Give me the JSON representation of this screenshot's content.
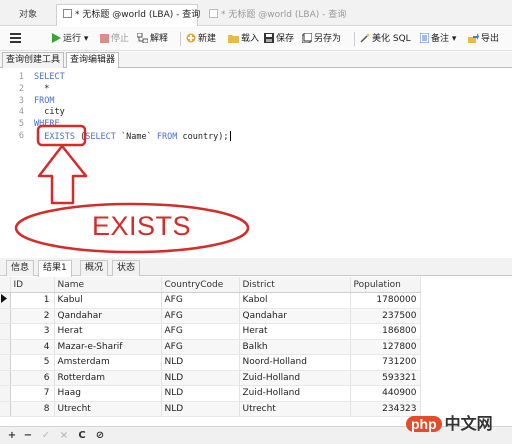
{
  "window_tabs": {
    "objects": "对象",
    "active": "* 无标题 @world (LBA) - 查询",
    "inactive": "* 无标题 @world (LBA) - 查询"
  },
  "toolbar": {
    "menu_icon": "hamburger-icon",
    "run": "运行 ▾",
    "stop": "停止",
    "explain": "解释",
    "new": "新建",
    "load": "载入",
    "save": "保存",
    "save_as": "另存为",
    "beautify": "美化 SQL",
    "memo": "备注 ▾",
    "export": "导出"
  },
  "sub_tabs": {
    "builder": "查询创建工具",
    "editor": "查询编辑器"
  },
  "editor": {
    "lines": [
      {
        "n": "1",
        "html_parts": [
          {
            "t": "SELECT",
            "kw": true
          }
        ]
      },
      {
        "n": "2",
        "html_parts": [
          {
            "t": "  *",
            "kw": false
          }
        ]
      },
      {
        "n": "3",
        "html_parts": [
          {
            "t": "FROM",
            "kw": true
          }
        ]
      },
      {
        "n": "4",
        "html_parts": [
          {
            "t": "  city",
            "kw": false
          }
        ]
      },
      {
        "n": "5",
        "html_parts": [
          {
            "t": "WHERE",
            "kw": true
          }
        ]
      },
      {
        "n": "6",
        "html_parts": [
          {
            "t": "  EXISTS",
            "kw": true
          },
          {
            "t": " (",
            "kw": false
          },
          {
            "t": "SELECT",
            "kw": true
          },
          {
            "t": " `Name` ",
            "kw": false
          },
          {
            "t": "FROM",
            "kw": true
          },
          {
            "t": " country);",
            "kw": false
          }
        ]
      }
    ]
  },
  "annotation": {
    "label": "EXISTS",
    "color": "#d42b2b"
  },
  "result_tabs": {
    "info": "信息",
    "result1": "结果1",
    "overview": "概况",
    "status": "状态"
  },
  "table": {
    "headers": [
      "ID",
      "Name",
      "CountryCode",
      "District",
      "Population"
    ],
    "rows": [
      [
        "1",
        "Kabul",
        "AFG",
        "Kabol",
        "1780000"
      ],
      [
        "2",
        "Qandahar",
        "AFG",
        "Qandahar",
        "237500"
      ],
      [
        "3",
        "Herat",
        "AFG",
        "Herat",
        "186800"
      ],
      [
        "4",
        "Mazar-e-Sharif",
        "AFG",
        "Balkh",
        "127800"
      ],
      [
        "5",
        "Amsterdam",
        "NLD",
        "Noord-Holland",
        "731200"
      ],
      [
        "6",
        "Rotterdam",
        "NLD",
        "Zuid-Holland",
        "593321"
      ],
      [
        "7",
        "Haag",
        "NLD",
        "Zuid-Holland",
        "440900"
      ],
      [
        "8",
        "Utrecht",
        "NLD",
        "Utrecht",
        "234323"
      ]
    ]
  },
  "bottom_bar": {
    "add": "+",
    "remove": "−",
    "apply": "✓",
    "discard": "×",
    "refresh": "C",
    "stop": "⊘"
  },
  "watermark": {
    "badge": "php",
    "text": "中文网"
  }
}
